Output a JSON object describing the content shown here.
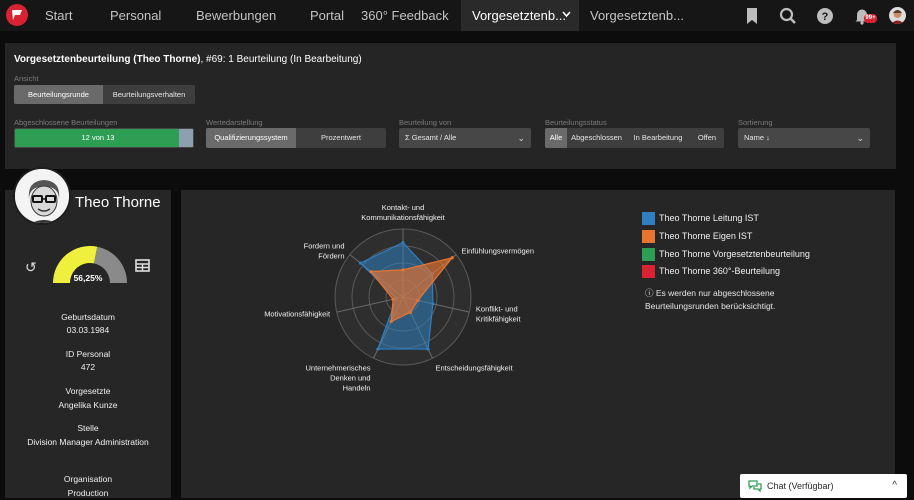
{
  "nav": {
    "items": [
      "Start",
      "Personal",
      "Bewerbungen",
      "Portal",
      "360° Feedback",
      "Vorgesetztenb...",
      "Vorgesetztenb..."
    ],
    "notification_count": "99+"
  },
  "panel": {
    "title_bold": "Vorgesetztenbeurteilung (Theo Thorne)",
    "title_rest": ", #69: 1 Beurteilung (In Bearbeitung)",
    "view_label": "Ansicht",
    "view_options": [
      "Beurteilungsrunde",
      "Beurteilungsverhalten"
    ],
    "completed_label": "Abgeschlossene Beurteilungen",
    "completed_text": "12 von 13",
    "completed_progress": 0.92,
    "value_display_label": "Wertedarstellung",
    "value_display_options": [
      "Qualifizierungssystem",
      "Prozentwert"
    ],
    "rating_by_label": "Beurteilung von",
    "rating_by_value": "Σ  Gesamt / Alle",
    "status_label": "Beurteilungsstatus",
    "status_options": [
      "Alle",
      "Abgeschlossen",
      "In Bearbeitung",
      "Offen"
    ],
    "sort_label": "Sortierung",
    "sort_value": "Name ↓"
  },
  "profile": {
    "name": "Theo Thorne",
    "gauge_value": "56,25%",
    "gauge_fraction": 0.5625,
    "birth_label": "Geburtsdatum",
    "birth_value": "03.03.1984",
    "id_label": "ID Personal",
    "id_value": "472",
    "boss_label": "Vorgesetzte",
    "boss_value": "Angelika Kunze",
    "position_label": "Stelle",
    "position_value": "Division Manager Administration",
    "org_label": "Organisation",
    "org_value": "Production"
  },
  "chart_data": {
    "type": "radar",
    "axes": [
      [
        "Kontakt- und",
        "Kommunikationsfähigkeit"
      ],
      [
        "Einfühlungsvermögen"
      ],
      [
        "Konflikt- und",
        "Kritikfähigkeit"
      ],
      [
        "Entscheidungsfähigkeit"
      ],
      [
        "Unternehmerisches",
        "Denken und",
        "Handeln"
      ],
      [
        "Motivationsfähigkeit"
      ],
      [
        "Fordern und",
        "Fördern"
      ]
    ],
    "range": [
      0,
      4
    ],
    "series": [
      {
        "name": "Theo Thorne Leitung IST",
        "color": "#2f7fc1",
        "values": [
          3.2,
          2.2,
          1.8,
          3.4,
          3.4,
          0.4,
          3.2
        ]
      },
      {
        "name": "Theo Thorne Eigen IST",
        "color": "#e8742f",
        "values": [
          1.6,
          3.7,
          0.9,
          1.0,
          1.6,
          0.6,
          2.4
        ]
      },
      {
        "name": "Theo Thorne Vorgesetztenbeurteilung",
        "color": "#2f9e55",
        "values": []
      },
      {
        "name": "Theo Thorne 360°-Beurteilung",
        "color": "#d92333",
        "values": []
      }
    ],
    "note": "ⓘ  Es werden nur abgeschlossene Beurteilungsrunden berücksichtigt."
  },
  "chat": {
    "label": "Chat (Verfügbar)"
  }
}
